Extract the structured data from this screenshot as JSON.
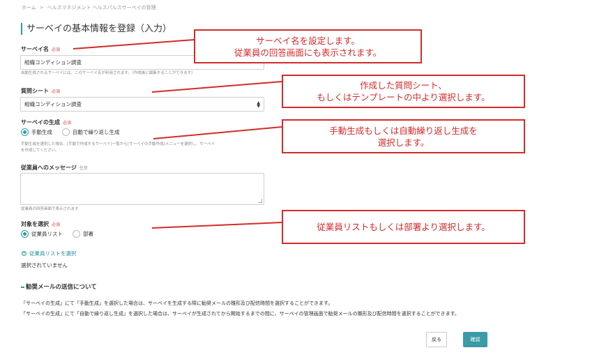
{
  "breadcrumb": {
    "items": [
      "ホーム",
      "ヘルスマネジメント ヘルスパルスサーベイの管理"
    ],
    "separator": ">"
  },
  "page_title": "サーベイの基本情報を登録（入力）",
  "survey_name": {
    "label": "サーベイ名",
    "required": "必須",
    "value": "組織コンディション調査",
    "help": "自動生成されるサーベイには、このサーベイ名が利用されます。（作成後に編集することができます）"
  },
  "question_sheet": {
    "label": "質問シート",
    "required": "必須",
    "selected": "組織コンディション調査"
  },
  "generation": {
    "label": "サーベイの生成",
    "required": "必須",
    "options": [
      "手動生成",
      "自動で繰り返し生成"
    ],
    "selected_index": 0,
    "help_lines": [
      "手動生成を選択した場合、[手動で作成するサーベイ]一覧から[サーベイの手動作成]メニューを選択し、サーベイ",
      "を作成してください。"
    ]
  },
  "message": {
    "label": "従業員へのメッセージ",
    "optional": "任意",
    "value": "",
    "help": "従業員の回答画面で表示されます"
  },
  "target": {
    "label": "対象を選択",
    "required": "必須",
    "options": [
      "従業員リスト",
      "部署"
    ],
    "selected_index": 0,
    "select_link": "従業員リストを選択",
    "none_selected": "選択されていません"
  },
  "reminder": {
    "title": "勧奨メールの送信について",
    "lines": [
      "「サーベイの生成」にて「手動生成」を選択した場合は、サーベイを生成する際に勧奨メールの雛形及び配信時間を選択することができます。",
      "「サーベイの生成」にて「自動で繰り返し生成」を選択した場合は、サーベイが生成されてから開始するまでの間に、サーベイの管理画面で勧奨メールの雛形及び配信時間を選択することができます。"
    ]
  },
  "buttons": {
    "back": "戻る",
    "confirm": "確認"
  },
  "callouts": [
    {
      "lines": [
        "サーベイ名を設定します。",
        "従業員の回答画面にも表示されます。"
      ]
    },
    {
      "lines": [
        "作成した質問シート、",
        "もしくはテンプレートの中より選択します。"
      ]
    },
    {
      "lines": [
        "手動生成もしくは自動繰り返し生成を",
        "選択します。"
      ]
    },
    {
      "lines": [
        "従業員リストもしくは部署より選択します。"
      ]
    }
  ],
  "colors": {
    "accent": "#2a9aa8",
    "required": "#e04848",
    "callout": "#d42a2a",
    "link": "#2a8fa0"
  }
}
